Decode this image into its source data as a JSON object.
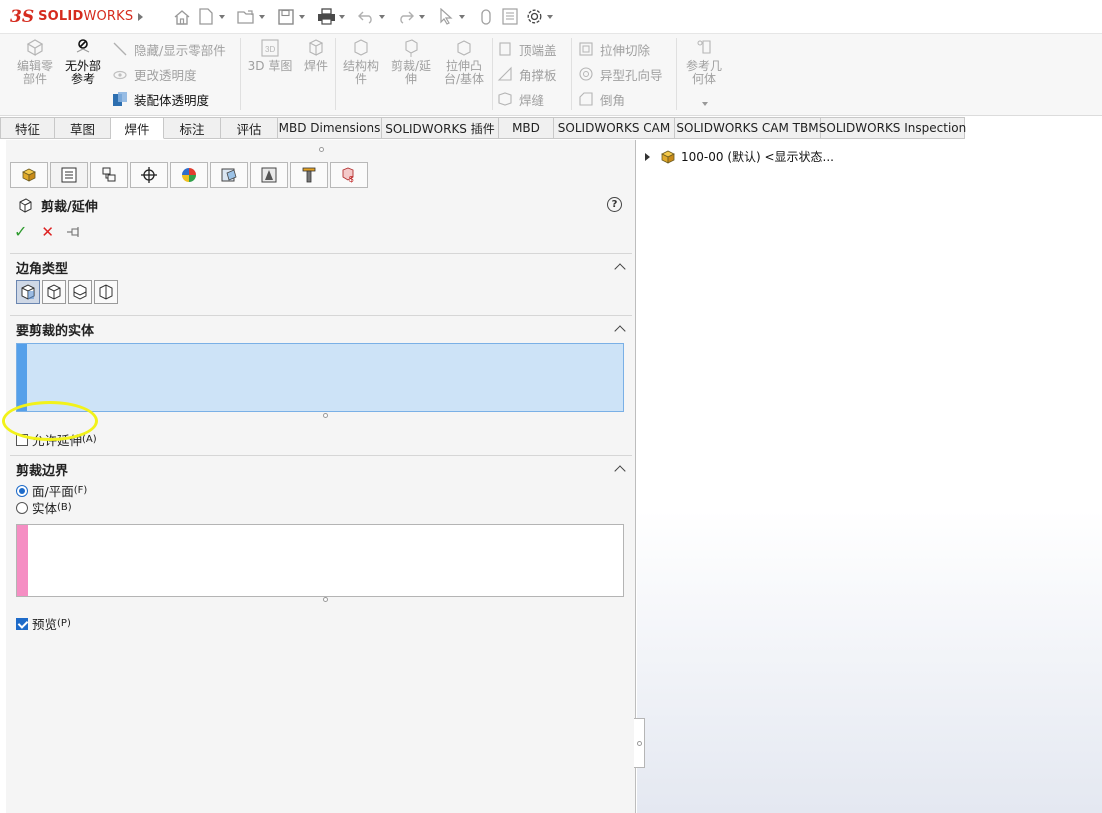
{
  "app": {
    "logo_mark": "3S",
    "logo_bold": "SOLID",
    "logo_light": "WORKS"
  },
  "command_manager": {
    "edit_part": "编辑零\n部件",
    "no_external_refs": "无外部\n参考",
    "hide_show_parts": "隐藏/显示零部件",
    "change_transparency": "更改透明度",
    "assembly_transparency": "装配体透明度",
    "sketch_3d": "3D 草图",
    "weldments": "焊件",
    "structural_member": "结构构\n件",
    "trim_extend": "剪裁/延\n伸",
    "extruded_boss": "拉伸凸\n台/基体",
    "end_cap": "顶端盖",
    "gusset": "角撑板",
    "weld_bead": "焊缝",
    "extruded_cut": "拉伸切除",
    "hole_wizard": "异型孔向导",
    "chamfer": "倒角",
    "reference_geometry": "参考几\n何体"
  },
  "tabs": [
    {
      "label": "特征"
    },
    {
      "label": "草图"
    },
    {
      "label": "焊件"
    },
    {
      "label": "标注"
    },
    {
      "label": "评估"
    },
    {
      "label": "MBD Dimensions"
    },
    {
      "label": "SOLIDWORKS 插件"
    },
    {
      "label": "MBD"
    },
    {
      "label": "SOLIDWORKS CAM"
    },
    {
      "label": "SOLIDWORKS CAM TBM"
    },
    {
      "label": "SOLIDWORKS Inspection"
    }
  ],
  "property_manager": {
    "title": "剪裁/延伸",
    "help": "?",
    "ok": "✓",
    "cancel": "✕",
    "corner_type": {
      "heading": "边角类型"
    },
    "bodies_to_trim": {
      "heading": "要剪裁的实体",
      "allow_extension_label": "允许延伸",
      "allow_extension_hotkey": "(A)",
      "allow_extension_checked": false
    },
    "trim_boundary": {
      "heading": "剪裁边界",
      "option_face": "面/平面",
      "option_face_hotkey": "(F)",
      "option_body": "实体",
      "option_body_hotkey": "(B)",
      "selected": "face"
    },
    "preview_label": "预览",
    "preview_hotkey": "(P)",
    "preview_checked": true
  },
  "feature_tree": {
    "item": "100-00 (默认) <显示状态..."
  },
  "colors": {
    "accent_red": "#d52b1e",
    "selection_blue": "#cde3f7",
    "boundary_pink": "#f58ec3",
    "highlight_yellow": "#f2f21a",
    "ok_green": "#2e9b2e"
  }
}
